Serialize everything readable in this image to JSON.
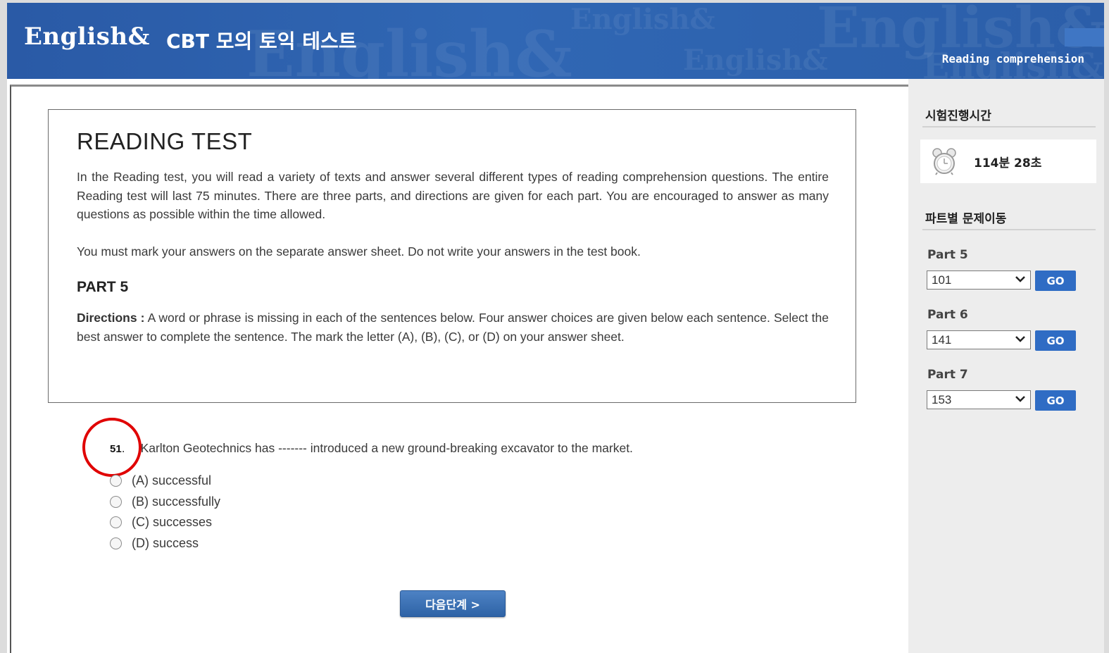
{
  "header": {
    "logo": "English&",
    "app_title": "CBT 모의 토익 테스트",
    "section_label": "Reading comprehension",
    "watermark": "English&"
  },
  "instructions": {
    "title": "READING TEST",
    "paragraph1": "In the Reading test, you will read a variety of texts and answer several different types of reading comprehension questions. The entire Reading test will last 75 minutes. There are three parts, and directions are given for each part. You are encouraged to answer as many questions as possible within the time allowed.",
    "paragraph2": "You must mark your answers on the separate answer sheet. Do not write your answers in the test book.",
    "part_title": "PART 5",
    "directions_label": "Directions :",
    "directions_text": " A word or phrase is missing in each of the sentences below. Four answer choices are given below each sentence. Select the best answer to complete the sentence. The mark the letter (A), (B), (C), or (D) on your answer sheet."
  },
  "question": {
    "number": "51",
    "dot": ".",
    "text": "Karlton Geotechnics has ------- introduced a new ground-breaking excavator to the market.",
    "options": [
      {
        "label": "(A) successful"
      },
      {
        "label": "(B) successfully"
      },
      {
        "label": "(C) successes"
      },
      {
        "label": "(D) success"
      }
    ]
  },
  "next_button": "다음단계 >",
  "sidebar": {
    "timer_heading": "시험진행시간",
    "timer_value": "114분 28초",
    "nav_heading": "파트별 문제이동",
    "parts": [
      {
        "label": "Part 5",
        "selected": "101",
        "go": "GO"
      },
      {
        "label": "Part 6",
        "selected": "141",
        "go": "GO"
      },
      {
        "label": "Part 7",
        "selected": "153",
        "go": "GO"
      }
    ]
  },
  "colors": {
    "header_blue": "#2f65b2",
    "button_blue": "#2f6cc4",
    "highlight_red": "#e00000"
  }
}
